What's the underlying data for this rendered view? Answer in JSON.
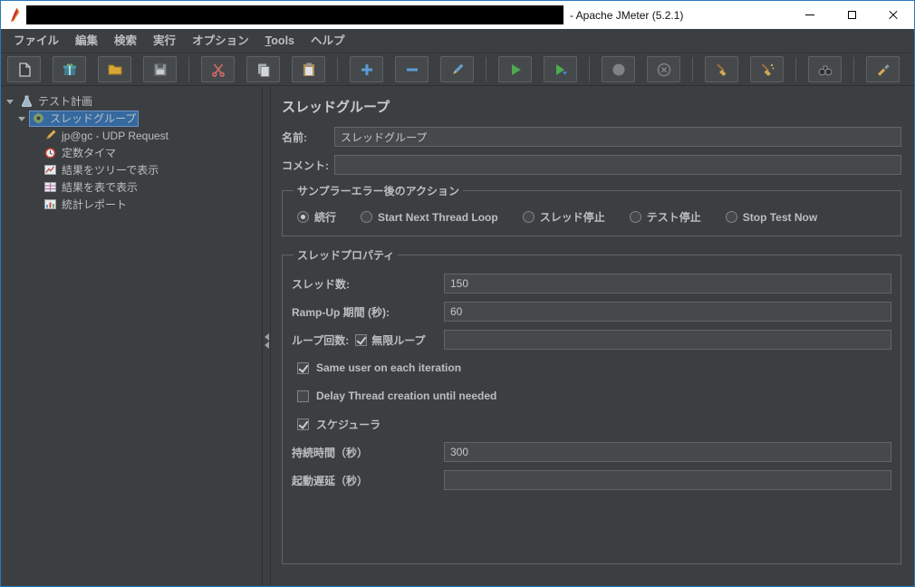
{
  "window": {
    "title": "- Apache JMeter (5.2.1)"
  },
  "colors": {
    "background": "#3c3f41",
    "field_bg": "#45494a",
    "field_border": "#646464",
    "text": "#bbbfc2",
    "selection_blue": "#35699f",
    "title_bar": "#ffffff",
    "window_border": "#2878bd",
    "start_green": "#4daa4f",
    "cut_red": "#d26a66",
    "folder_yellow": "#d8a735",
    "add_blue": "#5c9bd6"
  },
  "menu": {
    "items": [
      {
        "id": "file",
        "label": "ファイル"
      },
      {
        "id": "edit",
        "label": "編集"
      },
      {
        "id": "search",
        "label": "検索"
      },
      {
        "id": "run",
        "label": "実行"
      },
      {
        "id": "options",
        "label": "オプション"
      },
      {
        "id": "tools",
        "label": "Tools",
        "underline_first": true
      },
      {
        "id": "help",
        "label": "ヘルプ"
      }
    ]
  },
  "toolbar": {
    "groups": [
      [
        "new-plan",
        "templates",
        "open",
        "save"
      ],
      [
        "cut",
        "copy",
        "paste"
      ],
      [
        "add",
        "remove",
        "edit"
      ],
      [
        "start",
        "start-no-pauses"
      ],
      [
        "stop",
        "shutdown"
      ],
      [
        "clear",
        "clear-all"
      ],
      [
        "search"
      ],
      [
        "search-reset"
      ]
    ],
    "disabled": [
      "stop",
      "shutdown"
    ]
  },
  "tree": {
    "items": [
      {
        "label": "テスト計画",
        "icon": "test-plan",
        "level": 0,
        "expandable": true,
        "selected": false
      },
      {
        "label": "スレッドグループ",
        "icon": "thread-group",
        "level": 1,
        "expandable": true,
        "selected": true
      },
      {
        "label": "jp@gc - UDP Request",
        "icon": "udp-sampler",
        "level": 2,
        "expandable": false,
        "selected": false
      },
      {
        "label": "定数タイマ",
        "icon": "constant-timer",
        "level": 2,
        "expandable": false,
        "selected": false
      },
      {
        "label": "結果をツリーで表示",
        "icon": "view-results-tree",
        "level": 2,
        "expandable": false,
        "selected": false
      },
      {
        "label": "結果を表で表示",
        "icon": "view-results-table",
        "level": 2,
        "expandable": false,
        "selected": false
      },
      {
        "label": "統計レポート",
        "icon": "aggregate-report",
        "level": 2,
        "expandable": false,
        "selected": false
      }
    ]
  },
  "main": {
    "title": "スレッドグループ",
    "name": {
      "label": "名前:",
      "value": "スレッドグループ"
    },
    "comment": {
      "label": "コメント:",
      "value": ""
    },
    "action_group": {
      "title": "サンプラーエラー後のアクション",
      "options": [
        {
          "id": "continue",
          "label": "続行",
          "selected": true
        },
        {
          "id": "start-next-loop",
          "label": "Start Next Thread Loop",
          "selected": false
        },
        {
          "id": "stop-thread",
          "label": "スレッド停止",
          "selected": false
        },
        {
          "id": "stop-test",
          "label": "テスト停止",
          "selected": false
        },
        {
          "id": "stop-test-now",
          "label": "Stop Test Now",
          "selected": false
        }
      ]
    },
    "thread_props": {
      "title": "スレッドプロパティ",
      "threads": {
        "label": "スレッド数:",
        "value": "150"
      },
      "rampup": {
        "label": "Ramp-Up 期間 (秒):",
        "value": "60"
      },
      "loop": {
        "label": "ループ回数:",
        "infinite_label": "無限ループ",
        "infinite_checked": true,
        "value": ""
      },
      "same_user": {
        "label": "Same user on each iteration",
        "checked": true
      },
      "delay_create": {
        "label": "Delay Thread creation until needed",
        "checked": false
      },
      "scheduler": {
        "label": "スケジューラ",
        "checked": true
      },
      "duration": {
        "label": "持続時間（秒）",
        "value": "300"
      },
      "startup_delay": {
        "label": "起動遅延（秒）",
        "value": ""
      }
    }
  }
}
